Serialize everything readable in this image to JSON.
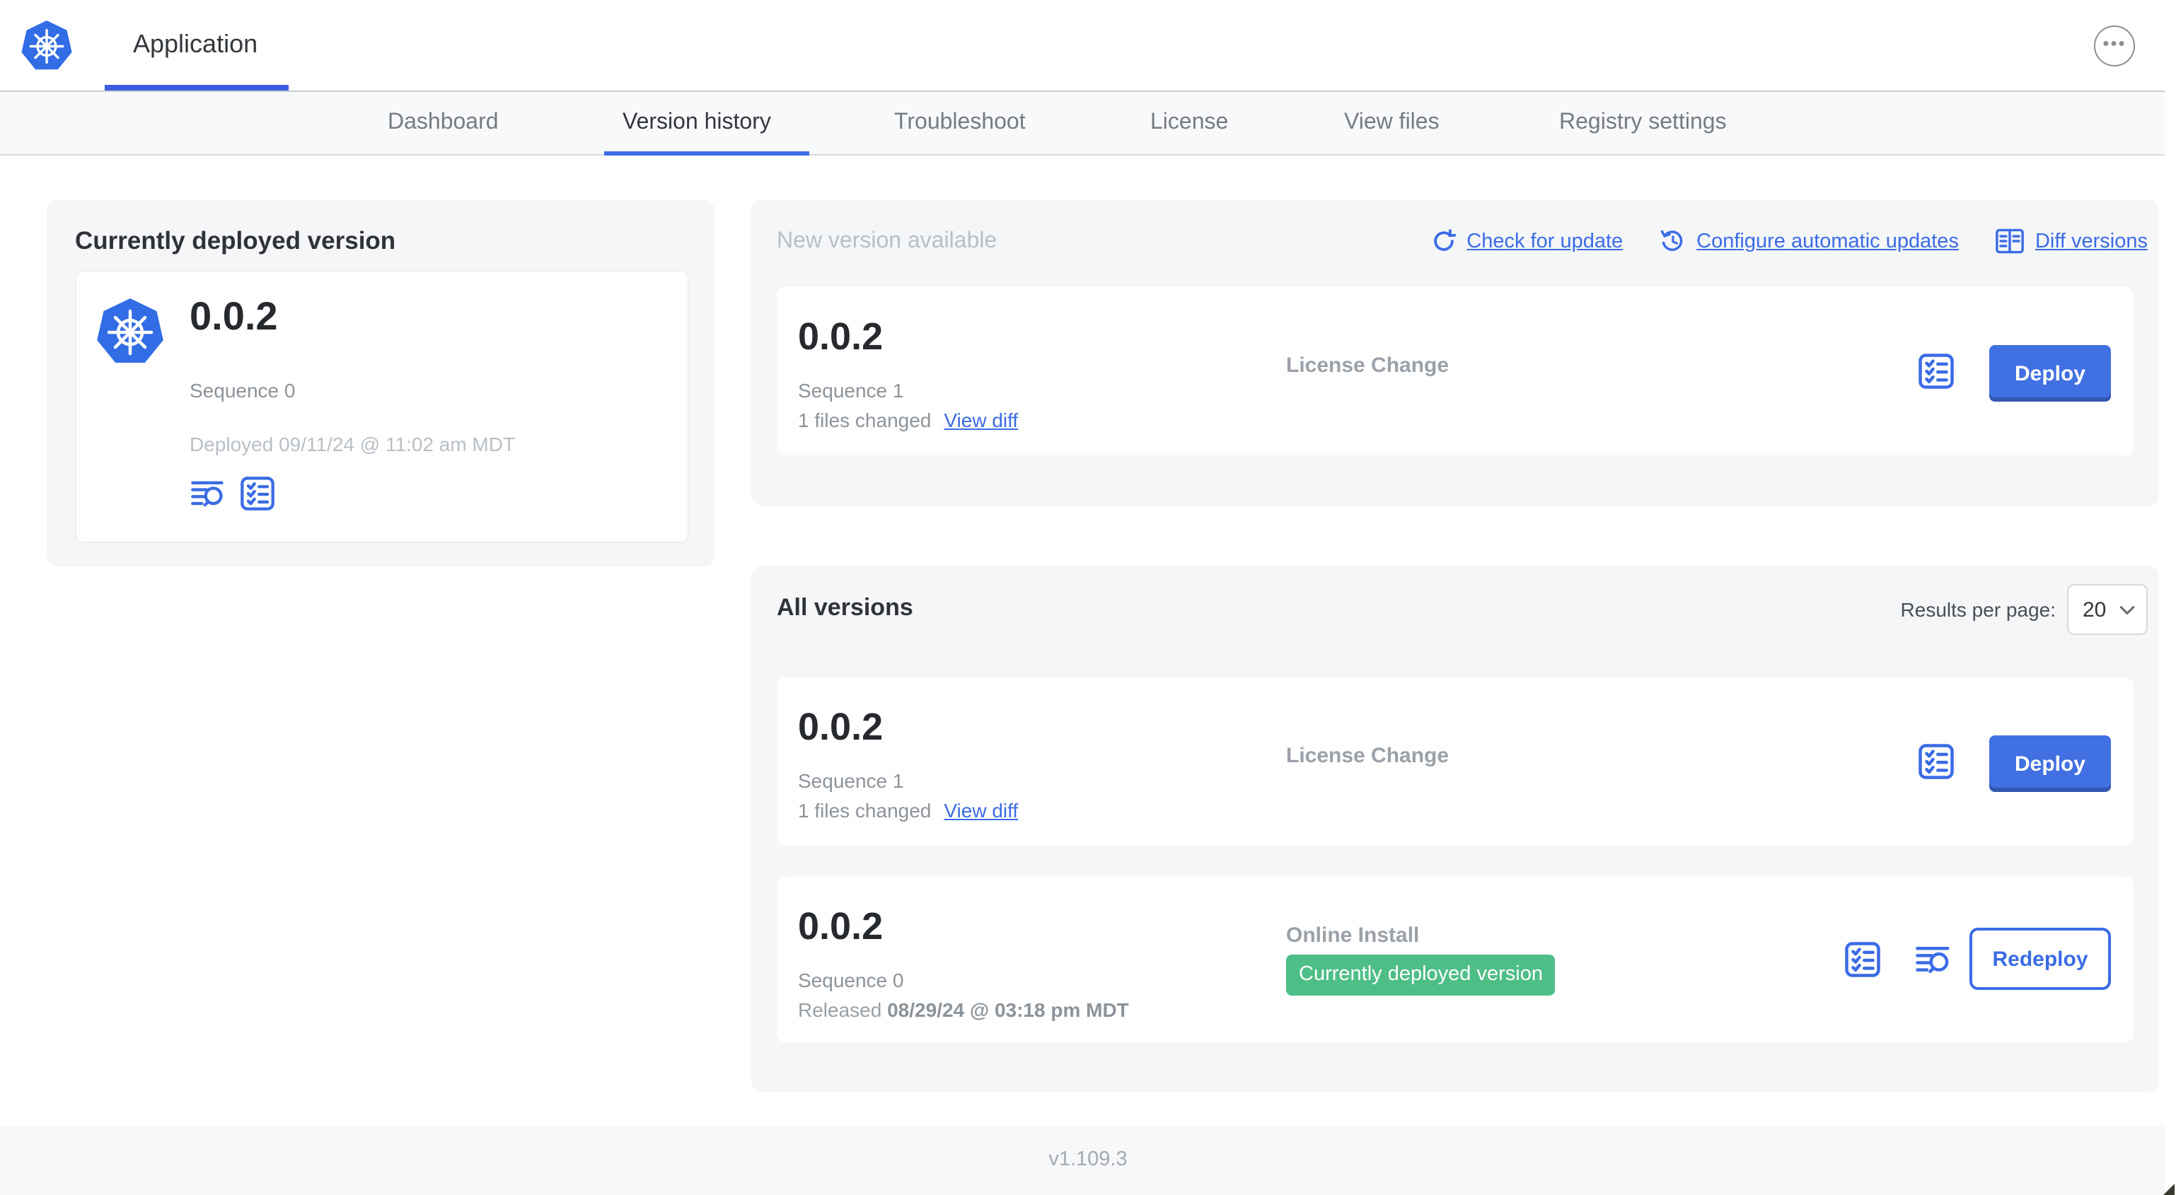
{
  "header": {
    "app_title": "Application"
  },
  "nav": {
    "tabs": [
      {
        "label": "Dashboard",
        "active": false
      },
      {
        "label": "Version history",
        "active": true
      },
      {
        "label": "Troubleshoot",
        "active": false
      },
      {
        "label": "License",
        "active": false
      },
      {
        "label": "View files",
        "active": false
      },
      {
        "label": "Registry settings",
        "active": false
      }
    ]
  },
  "current_version_card": {
    "title": "Currently deployed version",
    "version": "0.0.2",
    "sequence": "Sequence 0",
    "deployed": "Deployed 09/11/24 @ 11:02 am MDT"
  },
  "new_version_section": {
    "title": "New version available",
    "actions": [
      {
        "label": "Check for update",
        "icon": "refresh-icon"
      },
      {
        "label": "Configure automatic updates",
        "icon": "clock-refresh-icon"
      },
      {
        "label": "Diff versions",
        "icon": "diff-icon"
      }
    ],
    "row": {
      "version": "0.0.2",
      "sequence": "Sequence 1",
      "files_changed": "1 files changed",
      "view_diff_label": "View diff",
      "source": "License Change",
      "action_label": "Deploy"
    }
  },
  "all_versions_section": {
    "title": "All versions",
    "results_per_page_label": "Results per page:",
    "results_per_page_value": "20",
    "rows": [
      {
        "version": "0.0.2",
        "sequence": "Sequence 1",
        "files_changed": "1 files changed",
        "view_diff_label": "View diff",
        "source": "License Change",
        "action_label": "Deploy"
      },
      {
        "version": "0.0.2",
        "sequence": "Sequence 0",
        "released_prefix": "Released",
        "released_date": "08/29/24 @ 03:18 pm MDT",
        "source": "Online Install",
        "badge_label": "Currently deployed version",
        "action_label": "Redeploy"
      }
    ]
  },
  "footer": {
    "version": "v1.109.3"
  },
  "colors": {
    "accent_blue": "#3b6ce5",
    "kubernetes_blue": "#326de6",
    "deploy_button_blue": "#4170e2",
    "deployed_badge_green": "#4ebe87",
    "section_background": "#f4f6f8",
    "muted_text": "#8d939a"
  }
}
